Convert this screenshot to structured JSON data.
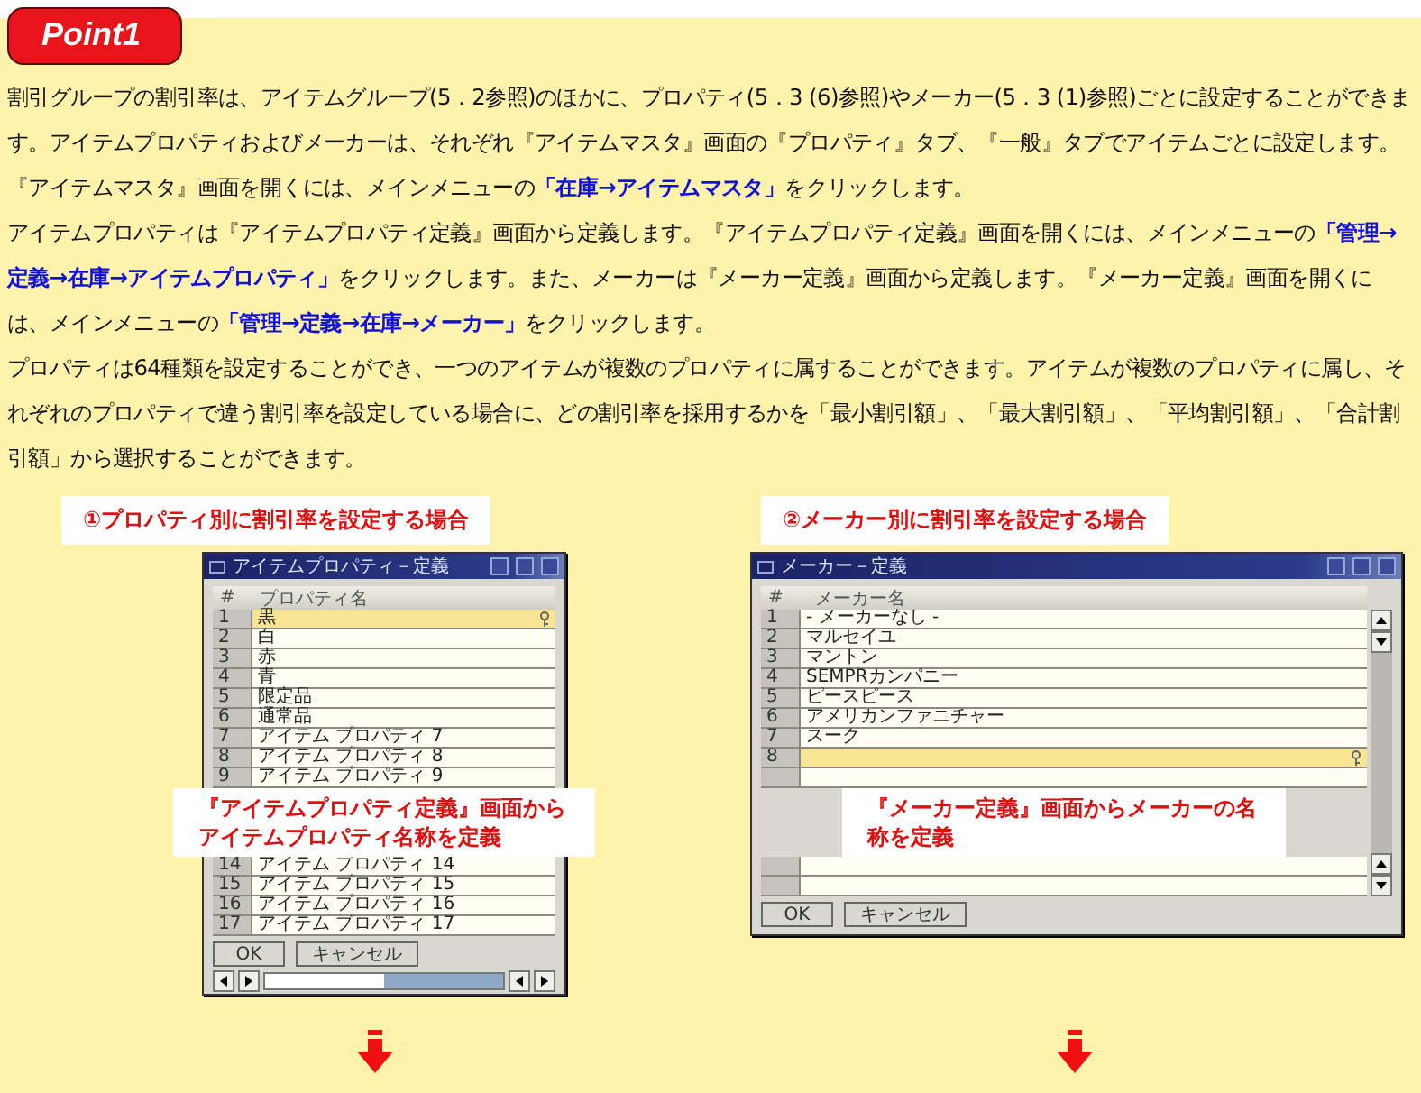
{
  "badge": {
    "text": "Point1"
  },
  "paragraphs": [
    "割引グループの割引率は、アイテムグループ(5．2参照)のほかに、プロパティ(5．3 (6)参照)やメーカー(5．3 (1)参照)ごとに設定することができます。アイテムプロパティおよびメーカーは、それぞれ『アイテムマスタ』画面の『プロパティ』タブ、『一般』タブでアイテムごとに設定します。『アイテムマスタ』画面を開くには、メインメニューの**「在庫→アイテムマスタ」**をクリックします。",
    "アイテムプロパティは『アイテムプロパティ定義』画面から定義します。『アイテムプロパティ定義』画面を開くには、メインメニューの**「管理→定義→在庫→アイテムプロパティ」**をクリックします。また、メーカーは『メーカー定義』画面から定義します。『メーカー定義』画面を開くには、メインメニューの**「管理→定義→在庫→メーカー」**をクリックします。",
    "プロパティは64種類を設定することができ、一つのアイテムが複数のプロパティに属することができます。アイテムが複数のプロパティに属し、それぞれのプロパティで違う割引率を設定している場合に、どの割引率を採用するかを「最小割引額」、「最大割引額」、「平均割引額」、「合計割引額」から選択することができます。"
  ],
  "examples": [
    {
      "caption": "①プロパティ別に割引率を設定する場合",
      "window": {
        "title": "アイテムプロパティ－定義",
        "columns": [
          "#",
          "プロパティ名"
        ],
        "grid": [
          {
            "kind": "row",
            "number": "1",
            "name": "黒",
            "selected": true
          },
          {
            "kind": "row",
            "number": "2",
            "name": "白",
            "selected": false
          },
          {
            "kind": "row",
            "number": "3",
            "name": "赤",
            "selected": false
          },
          {
            "kind": "row",
            "number": "4",
            "name": "青",
            "selected": false
          },
          {
            "kind": "row",
            "number": "5",
            "name": "限定品",
            "selected": false
          },
          {
            "kind": "row",
            "number": "6",
            "name": "通常品",
            "selected": false
          },
          {
            "kind": "row",
            "number": "7",
            "name": "アイテム プロパティ 7",
            "selected": false
          },
          {
            "kind": "row",
            "number": "8",
            "name": "アイテム プロパティ 8",
            "selected": false
          },
          {
            "kind": "row",
            "number": "9",
            "name": "アイテム プロパティ 9",
            "selected": false
          },
          {
            "kind": "callout",
            "text": "『アイテムプロパティ定義』画面からアイテムプロパティ名称を定義"
          },
          {
            "kind": "row",
            "number": "14",
            "name": "アイテム プロパティ 14",
            "selected": false
          },
          {
            "kind": "row",
            "number": "15",
            "name": "アイテム プロパティ 15",
            "selected": false
          },
          {
            "kind": "row",
            "number": "16",
            "name": "アイテム プロパティ 16",
            "selected": false
          },
          {
            "kind": "row",
            "number": "17",
            "name": "アイテム プロパティ 17",
            "selected": false
          }
        ],
        "buttons": [
          "OK",
          "キャンセル"
        ]
      }
    },
    {
      "caption": "②メーカー別に割引率を設定する場合",
      "window": {
        "title": "メーカー－定義",
        "columns": [
          "#",
          "メーカー名"
        ],
        "grid": [
          {
            "kind": "row",
            "number": "1",
            "name": "- メーカーなし -",
            "selected": false
          },
          {
            "kind": "row",
            "number": "2",
            "name": "マルセイユ",
            "selected": false
          },
          {
            "kind": "row",
            "number": "3",
            "name": "マントン",
            "selected": false
          },
          {
            "kind": "row",
            "number": "4",
            "name": "SEMPRカンパニー",
            "selected": false
          },
          {
            "kind": "row",
            "number": "5",
            "name": "ピースピース",
            "selected": false
          },
          {
            "kind": "row",
            "number": "6",
            "name": "アメリカンファニチャー",
            "selected": false
          },
          {
            "kind": "row",
            "number": "7",
            "name": "スーク",
            "selected": false
          },
          {
            "kind": "row",
            "number": "8",
            "selected": true
          },
          {
            "kind": "row",
            "selected": false
          },
          {
            "kind": "callout",
            "text": "『メーカー定義』画面からメーカーの名称を定義"
          },
          {
            "kind": "row",
            "selected": false
          },
          {
            "kind": "row",
            "selected": false
          }
        ],
        "buttons": [
          "OK",
          "キャンセル"
        ]
      }
    }
  ]
}
